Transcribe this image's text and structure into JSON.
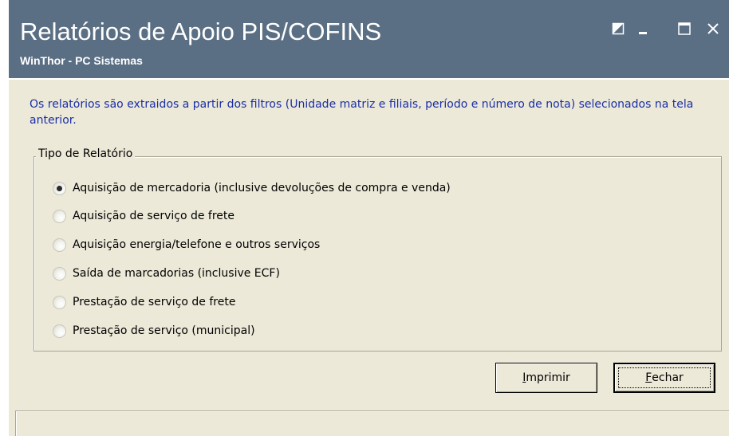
{
  "window": {
    "title": "Relatórios de Apoio PIS/COFINS",
    "subtitle": "WinThor - PC Sistemas",
    "header_color": "#5b6f84",
    "controls": [
      "restore-icon",
      "minimize-icon",
      "maximize-icon",
      "close-icon"
    ]
  },
  "info": {
    "text": "Os relatórios são extraidos a partir dos filtros (Unidade matriz e filiais, período e número de nota) selecionados na tela anterior.",
    "color": "#1a2ea8"
  },
  "report_type": {
    "legend": "Tipo de Relatório",
    "selected_index": 0,
    "options": [
      "Aquisição de mercadoria (inclusive devoluções de compra e venda)",
      "Aquisição de serviço de frete",
      "Aquisição energia/telefone e outros serviços",
      "Saída de marcadorias (inclusive ECF)",
      "Prestação de serviço de frete",
      "Prestação de serviço (municipal)"
    ]
  },
  "buttons": {
    "print_accel": "I",
    "print_rest": "mprimir",
    "close_accel": "F",
    "close_rest": "echar"
  }
}
